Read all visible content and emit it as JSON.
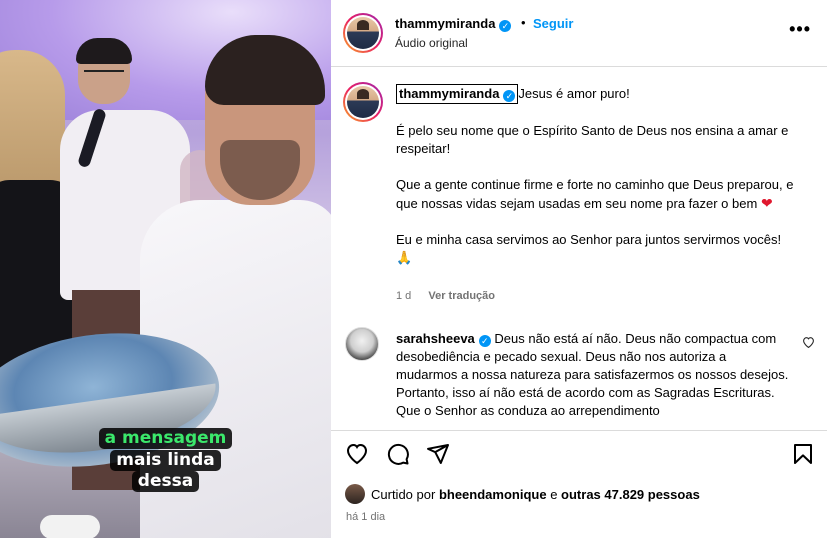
{
  "media": {
    "caption_lines": [
      "a mensagem",
      "mais linda",
      "dessa"
    ]
  },
  "header": {
    "username": "thammymiranda",
    "dot": "•",
    "follow_label": "Seguir",
    "audio_label": "Áudio original",
    "more_label": "•••"
  },
  "caption": {
    "username": "thammymiranda",
    "paragraphs": [
      "Jesus é amor puro!",
      "É pelo seu nome que o Espírito Santo de Deus nos ensina a amar e respeitar!",
      "Que a gente continue firme e forte no caminho que Deus preparou, e que nossas vidas sejam usadas em seu nome pra fazer o bem",
      "Eu e minha casa servimos ao Senhor para juntos servirmos vocês!"
    ],
    "heart_emoji": "❤",
    "pray_emoji": "🙏",
    "age": "1 d",
    "translate_label": "Ver tradução"
  },
  "comment": {
    "username": "sarahsheeva",
    "text": "Deus não está aí não. Deus não compactua com desobediência e pecado sexual. Deus não nos autoriza a mudarmos a nossa natureza para satisfazermos os nossos desejos. Portanto, isso aí não está de acordo com as Sagradas Escrituras. Que o Senhor as conduza ao arrependimento"
  },
  "likes": {
    "prefix": "Curtido por",
    "user": "bheendamonique",
    "middle": "e",
    "others": "outras 47.829 pessoas"
  },
  "time": "há 1 dia",
  "colors": {
    "accent": "#0095f6",
    "caption_green": "#3be86b",
    "heart": "#e0182e"
  }
}
